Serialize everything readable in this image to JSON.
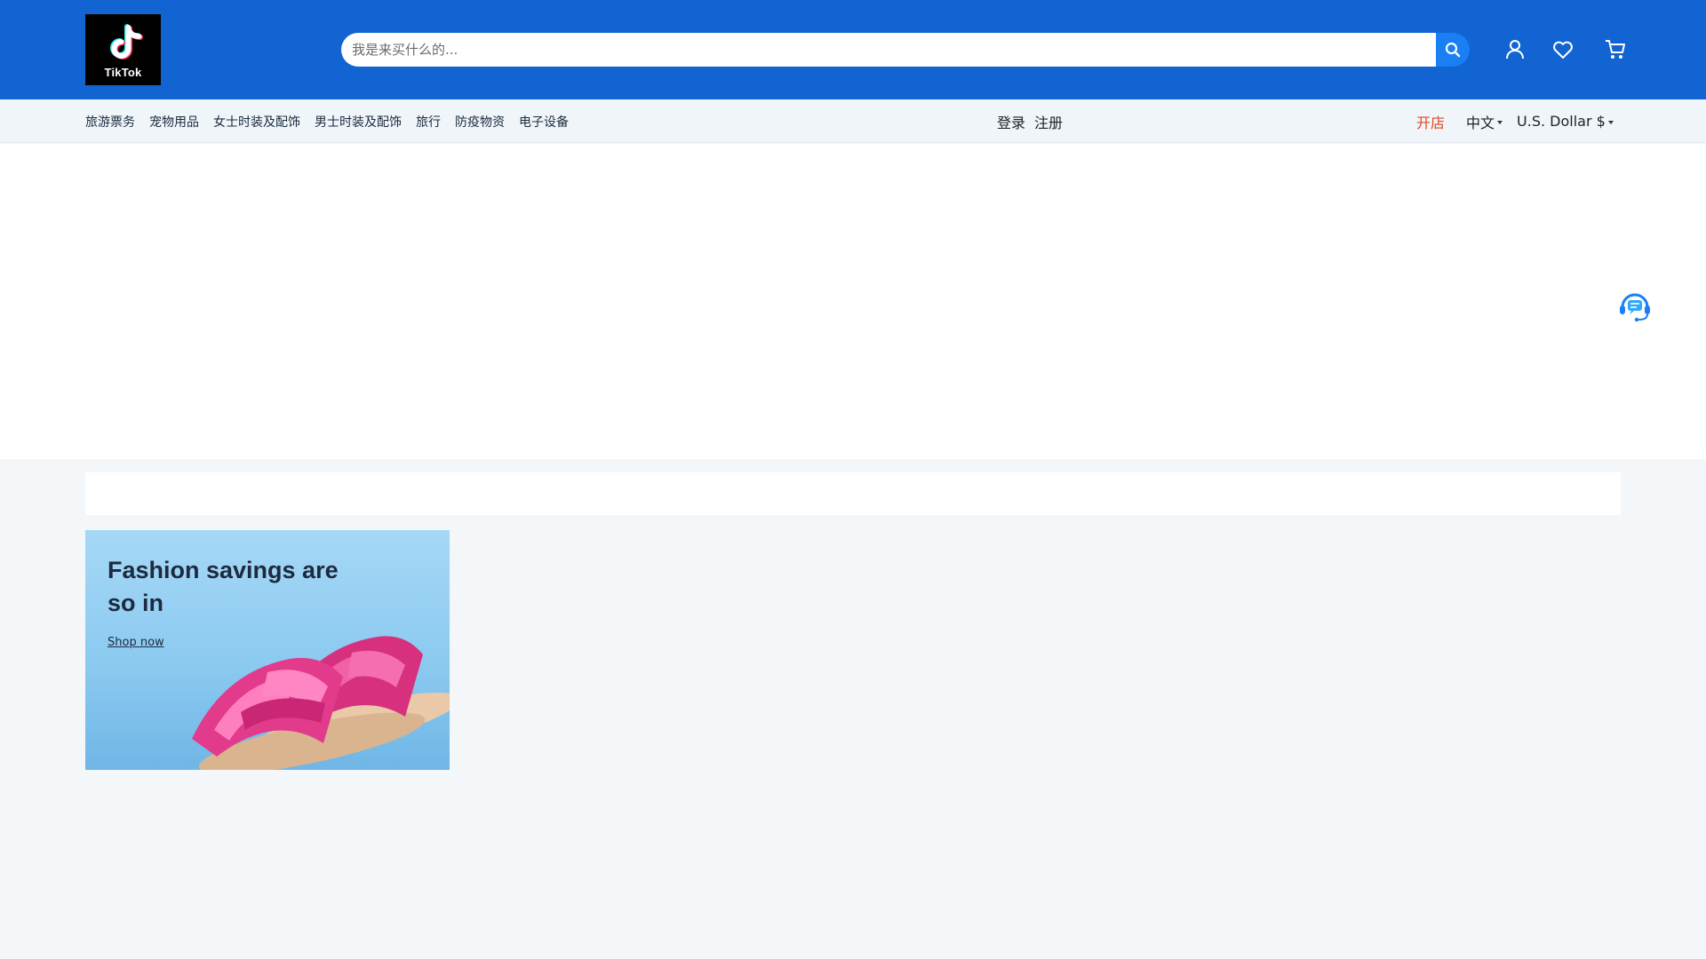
{
  "header": {
    "logo_text": "TikTok",
    "search": {
      "placeholder": "我是来买什么的...",
      "value": ""
    },
    "icons": [
      "search-icon",
      "user-icon",
      "heart-icon",
      "cart-icon"
    ],
    "brand_color": "#1264d2"
  },
  "nav": {
    "categories": [
      "旅游票务",
      "宠物用品",
      "女士时装及配饰",
      "男士时装及配饰",
      "旅行",
      "防疫物资",
      "电子设备"
    ],
    "login": "登录",
    "register": "注册",
    "open_shop": "开店",
    "language": "中文",
    "currency": "U.S. Dollar $"
  },
  "promo": {
    "title": "Fashion savings are so in",
    "link": "Shop now"
  },
  "colors": {
    "header": "#1264d2",
    "search_button": "#1a7ef5",
    "open_shop": "#e8451e",
    "promo_bg": "#8ccaf0",
    "sandal": "#e23b8c"
  }
}
